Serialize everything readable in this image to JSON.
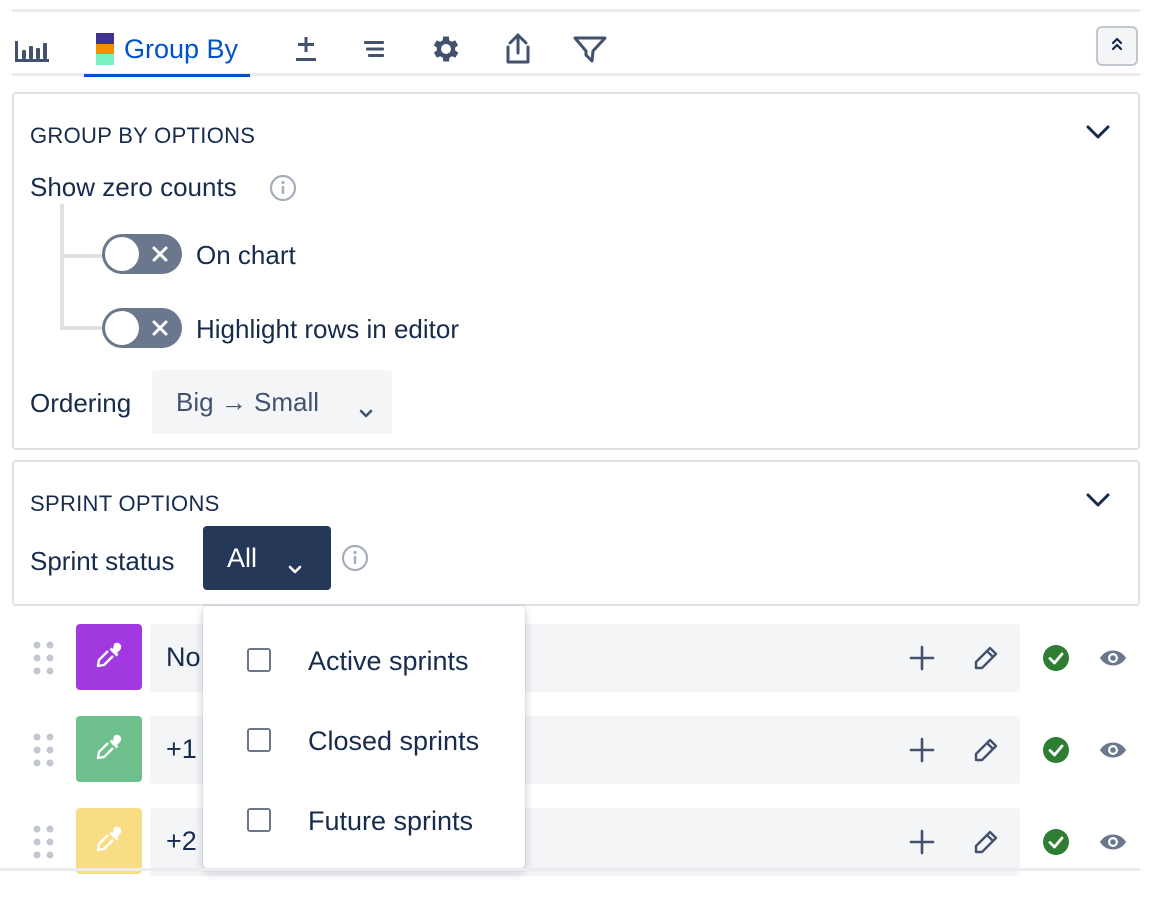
{
  "tabs": {
    "chart_icon": "bar-chart-icon",
    "group_by_label": "Group By",
    "group_by_colors": [
      "#403294",
      "#ff8b00",
      "#79f2c0"
    ],
    "other_icons": [
      "plus-minus-icon",
      "list-lines-icon",
      "gear-icon",
      "share-icon",
      "filter-icon"
    ],
    "collapse_icon": "chevrons-up-icon"
  },
  "group_by_options": {
    "title": "GROUP BY OPTIONS",
    "show_zero_counts_label": "Show zero counts",
    "on_chart_label": "On chart",
    "on_chart_enabled": false,
    "highlight_rows_label": "Highlight rows in editor",
    "highlight_rows_enabled": false,
    "ordering_label": "Ordering",
    "ordering_value": "Big → Small"
  },
  "sprint_options": {
    "title": "SPRINT OPTIONS",
    "sprint_status_label": "Sprint status",
    "sprint_status_value": "All"
  },
  "rows": [
    {
      "text": "No",
      "color": "#a239e0"
    },
    {
      "text": "+1",
      "color": "#6dbf8c"
    },
    {
      "text": "+2",
      "color": "#f8dd85"
    }
  ],
  "dropdown": {
    "options": [
      {
        "label": "Active sprints",
        "checked": false
      },
      {
        "label": "Closed sprints",
        "checked": false
      },
      {
        "label": "Future sprints",
        "checked": false
      }
    ]
  },
  "colors": {
    "accent": "#0052cc",
    "dark_select": "#253858",
    "success": "#2e7d32",
    "toggle_off": "#6b778c"
  }
}
